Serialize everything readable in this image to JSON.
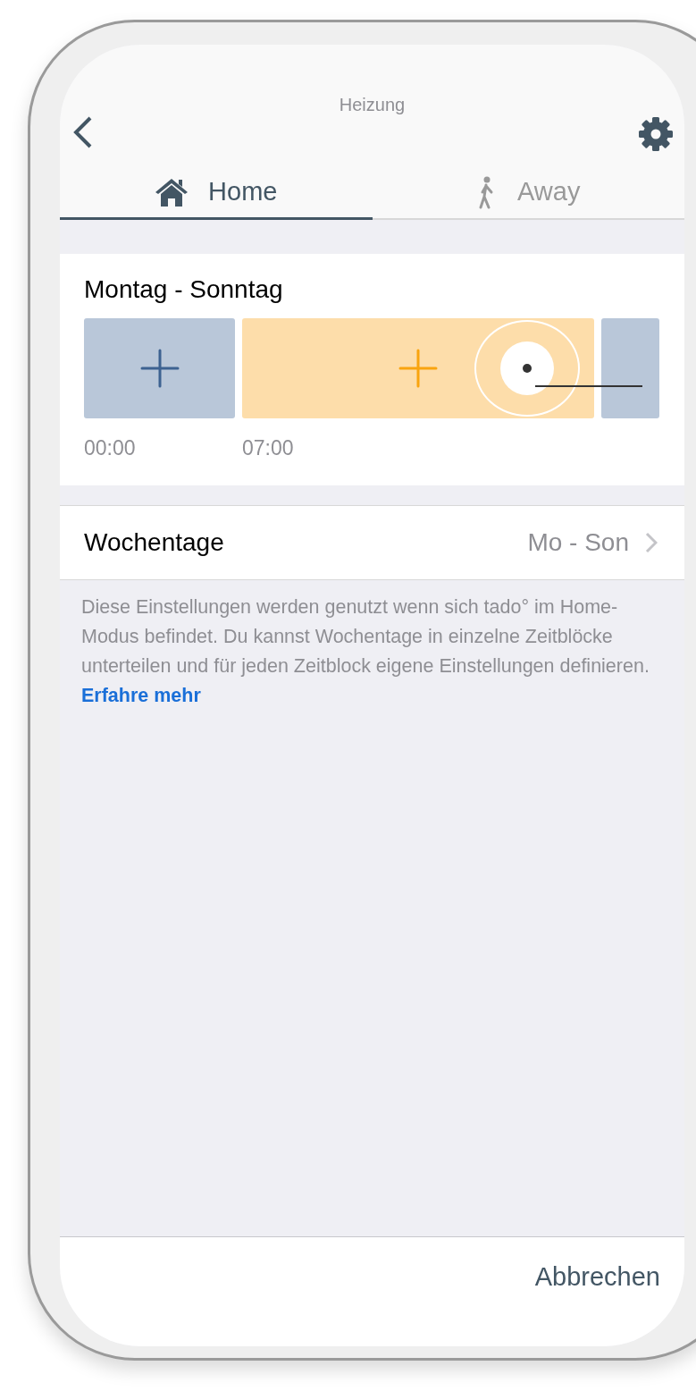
{
  "nav": {
    "title": "Heizung"
  },
  "tabs": [
    {
      "label": "Home",
      "kind": "home",
      "selected": true
    },
    {
      "label": "Away",
      "kind": "away",
      "selected": false
    }
  ],
  "schedule": {
    "title": "Montag - Sonntag",
    "blocks": [
      {
        "kind": "cold",
        "time": "00:00",
        "selected": false
      },
      {
        "kind": "warm",
        "time": "07:00",
        "selected": true
      },
      {
        "kind": "cold",
        "selected": false
      }
    ]
  },
  "weekdays_row": {
    "label": "Wochentage",
    "value": "Mo - Son"
  },
  "description": "Diese Einstellungen werden genutzt wenn sich tado° im Home-Modus befindet. Du kannst Wochentage in einzelne Zeitblöcke unterteilen und für jeden Zeitblock eigene Einstellungen definieren.",
  "link": "Erfahre mehr",
  "footer": {
    "cancel": "Abbrechen"
  }
}
